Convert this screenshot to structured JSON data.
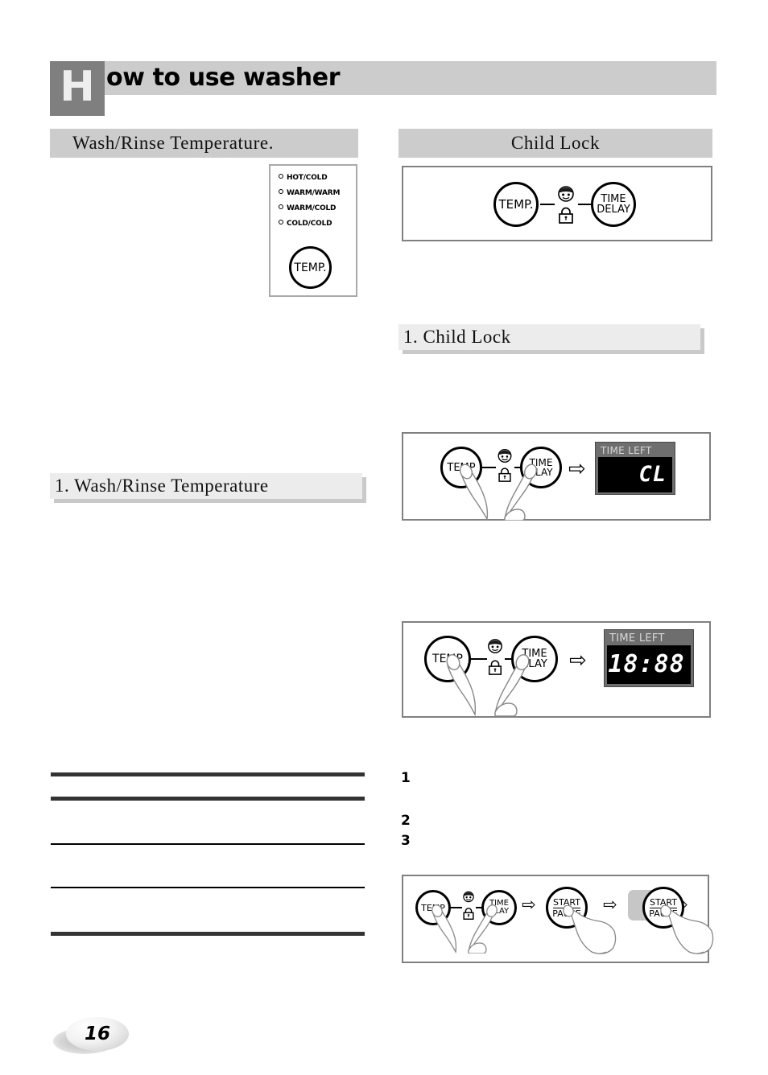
{
  "header": {
    "drop_cap": "H",
    "title": "ow to use washer",
    "bar_color": "#cccccc",
    "cap_block_color": "#7f7f7f"
  },
  "sections": {
    "wash_rinse_temperature": "Wash/Rinse Temperature.",
    "child_lock": "Child Lock"
  },
  "subheadings": {
    "child_lock": "1. Child Lock",
    "wash_rinse_temperature": "1. Wash/Rinse Temperature"
  },
  "temp_panel": {
    "options": [
      "HOT/COLD",
      "WARM/WARM",
      "WARM/COLD",
      "COLD/COLD"
    ],
    "button_label": "TEMP."
  },
  "buttons": {
    "temp": "TEMP.",
    "temp_short": "TEMP",
    "time_delay_line1": "TIME",
    "time_delay_line2": "DELAY",
    "time_delay_line2_short": "ELAY",
    "start_line1": "START",
    "start_line2": "PAUSE"
  },
  "icons": {
    "child_lock": "child-lock-icon",
    "arrow": "⇨",
    "hand": "pressing-hand-icon"
  },
  "displays": {
    "label": "TIME LEFT",
    "child_lock_value": "CL",
    "time_left_value": "18:88",
    "bezel_color": "#6e6e6e",
    "screen_color": "#000000",
    "segment_color": "#ffffff"
  },
  "list_numbers": [
    "1",
    "2",
    "3"
  ],
  "footer": {
    "page_number": "16"
  }
}
